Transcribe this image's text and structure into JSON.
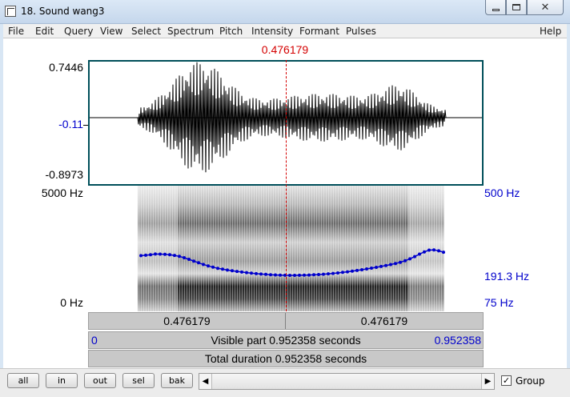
{
  "window": {
    "title": "18. Sound wang3"
  },
  "menu": [
    "File",
    "Edit",
    "Query",
    "View",
    "Select",
    "Spectrum",
    "Pitch",
    "Intensity",
    "Formant",
    "Pulses",
    "Help"
  ],
  "cursor": {
    "time": "0.476179",
    "position_fraction": 0.5
  },
  "waveform": {
    "max_label": "0.7446",
    "zero_label": "-0.11",
    "min_label": "-0.8973"
  },
  "spectrogram": {
    "top_freq_label": "5000 Hz",
    "bottom_freq_label": "0 Hz",
    "pitch_top_label": "500 Hz",
    "pitch_value_label": "191.3 Hz",
    "pitch_bottom_label": "75 Hz"
  },
  "selection_bar": {
    "left_value": "0.476179",
    "right_value": "0.476179"
  },
  "visible_bar": {
    "start": "0",
    "text": "Visible part 0.952358 seconds",
    "end": "0.952358"
  },
  "total_bar": {
    "text": "Total duration 0.952358 seconds"
  },
  "toolbar": {
    "buttons": [
      "all",
      "in",
      "out",
      "sel",
      "bak"
    ],
    "group_label": "Group",
    "group_checked": "✓"
  },
  "colors": {
    "cursor": "#d40000",
    "pitch": "#0000cc",
    "panel_border": "#004f5a"
  }
}
